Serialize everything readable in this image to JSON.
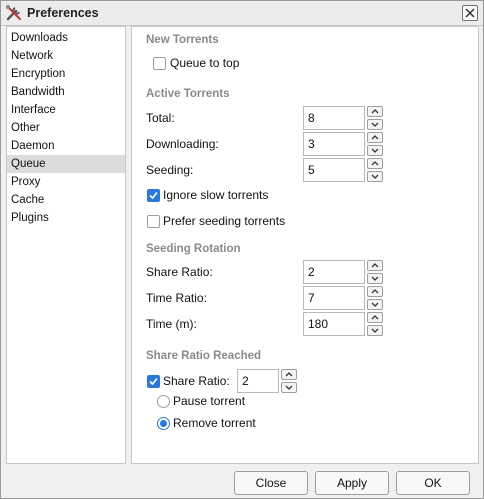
{
  "window": {
    "title": "Preferences"
  },
  "sidebar": {
    "items": [
      {
        "label": "Downloads"
      },
      {
        "label": "Network"
      },
      {
        "label": "Encryption"
      },
      {
        "label": "Bandwidth"
      },
      {
        "label": "Interface"
      },
      {
        "label": "Other"
      },
      {
        "label": "Daemon"
      },
      {
        "label": "Queue"
      },
      {
        "label": "Proxy"
      },
      {
        "label": "Cache"
      },
      {
        "label": "Plugins"
      }
    ],
    "selected": "Queue"
  },
  "new_torrents": {
    "title": "New Torrents",
    "queue_to_top": {
      "label": "Queue to top",
      "checked": false
    }
  },
  "active_torrents": {
    "title": "Active Torrents",
    "total": {
      "label": "Total:",
      "value": "8"
    },
    "downloading": {
      "label": "Downloading:",
      "value": "3"
    },
    "seeding": {
      "label": "Seeding:",
      "value": "5"
    },
    "ignore_slow": {
      "label": "Ignore slow torrents",
      "checked": true
    },
    "prefer_seeding": {
      "label": "Prefer seeding torrents",
      "checked": false
    }
  },
  "seeding_rotation": {
    "title": "Seeding Rotation",
    "share_ratio": {
      "label": "Share Ratio:",
      "value": "2"
    },
    "time_ratio": {
      "label": "Time Ratio:",
      "value": "7"
    },
    "time_m": {
      "label": "Time (m):",
      "value": "180"
    }
  },
  "share_ratio_reached": {
    "title": "Share Ratio Reached",
    "share_ratio": {
      "label": "Share Ratio:",
      "value": "2",
      "checked": true
    },
    "pause_torrent": {
      "label": "Pause torrent",
      "selected": false
    },
    "remove_torrent": {
      "label": "Remove torrent",
      "selected": true
    }
  },
  "buttons": {
    "close": "Close",
    "apply": "Apply",
    "ok": "OK"
  },
  "colors": {
    "accent": "#2c78d8"
  }
}
